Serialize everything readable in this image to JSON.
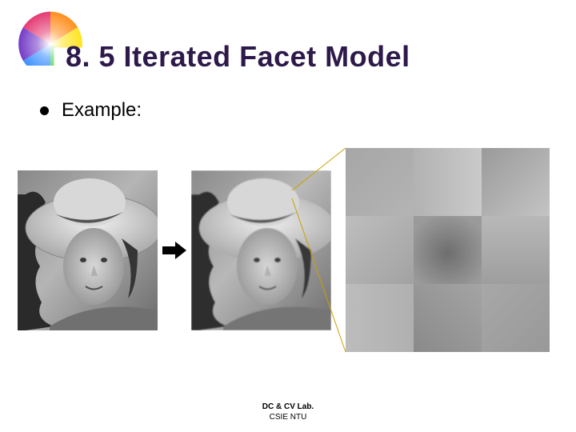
{
  "title": "8. 5 Iterated Facet Model",
  "bullet": {
    "label": "Example:"
  },
  "footer": {
    "line1": "DC & CV Lab.",
    "line2": "CSIE NTU"
  },
  "icons": {
    "color_wheel": "color-wheel-icon",
    "arrow": "arrow-right-icon"
  },
  "images": {
    "left": "grayscale-photo-woman-hat-original",
    "middle": "grayscale-photo-woman-hat-filtered",
    "right": "zoomed-facet-region-3x3"
  }
}
